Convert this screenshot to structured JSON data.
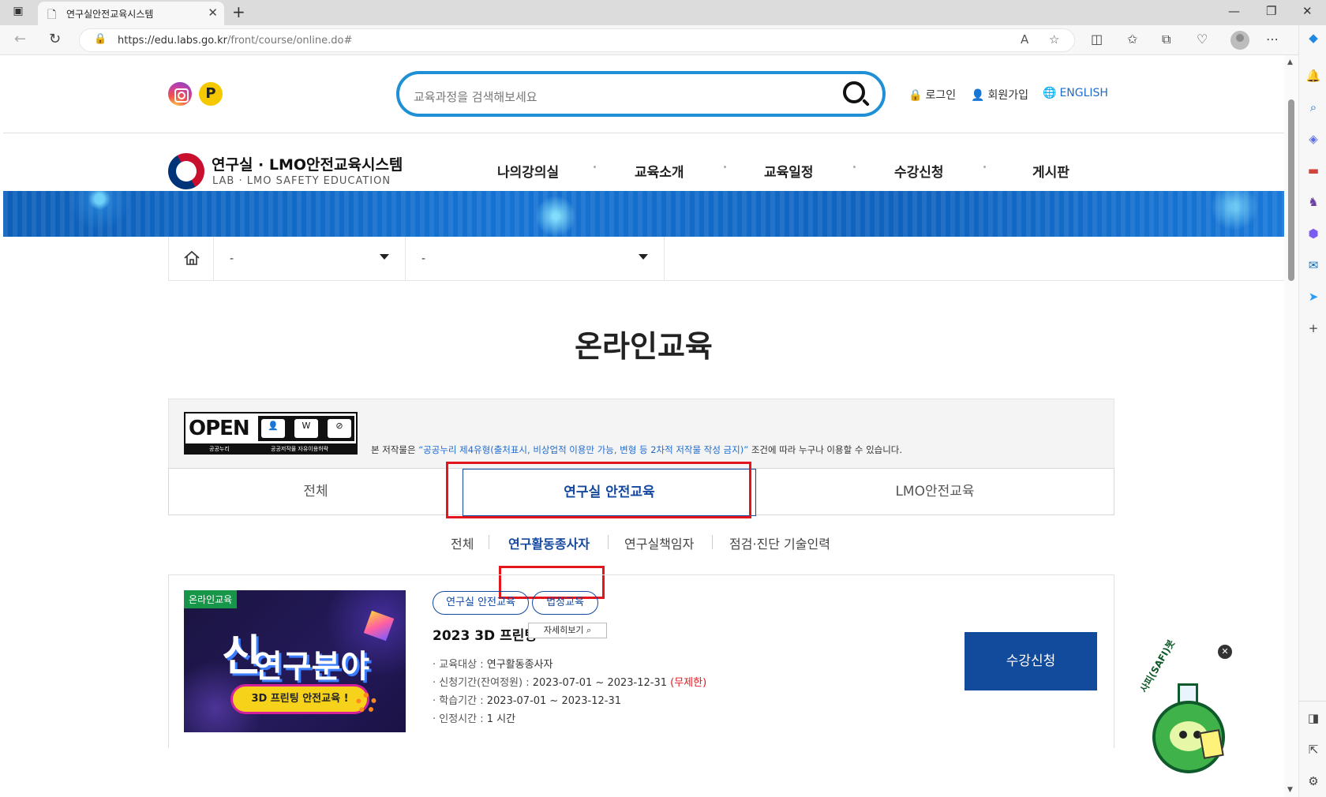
{
  "browser": {
    "tab_title": "연구실안전교육시스템",
    "url_host": "https://edu.labs.go.kr",
    "url_path": "/front/course/online.do#",
    "icons": [
      "sidebar-toggle-icon",
      "document-icon",
      "close-icon",
      "plus-icon",
      "back-icon",
      "reload-icon",
      "lock-icon",
      "read-aloud-icon",
      "favorite-star-icon",
      "split-screen-icon",
      "favorites-icon",
      "collections-icon",
      "browser-essentials-icon",
      "profile-icon",
      "more-icon",
      "copilot-icon"
    ]
  },
  "header": {
    "search_placeholder": "교육과정을 검색해보세요",
    "login": "로그인",
    "signup": "회원가입",
    "english": "ENGLISH",
    "logo_title": "연구실 · LMO안전교육시스템",
    "logo_sub": "LAB · LMO SAFETY EDUCATION",
    "sns_post_letter": "P"
  },
  "gnb": [
    "나의강의실",
    "교육소개",
    "교육일정",
    "수강신청",
    "게시판"
  ],
  "breadcrumb": {
    "select1": "-",
    "select2": "-"
  },
  "page_title": "온라인교육",
  "license": {
    "badge_open": "OPEN",
    "badge_left": "공공누리",
    "badge_right": "공공저작물 자유이용허락",
    "badge_items": [
      "출처표시",
      "상업용금지",
      "변경금지"
    ],
    "text_before": "본 저작물은 ",
    "text_highlight": "“공공누리 제4유형(출처표시, 비상업적 이용만 가능, 변형 등 2차적 저작물 작성 금지)”",
    "text_after": " 조건에 따라 누구나 이용할 수 있습니다."
  },
  "tabs": [
    "전체",
    "연구실 안전교육",
    "LMO안전교육"
  ],
  "active_tab": "연구실 안전교육",
  "subtabs": [
    "전체",
    "연구활동종사자",
    "연구실책임자",
    "점검·진단 기술인력"
  ],
  "active_subtab": "연구활동종사자",
  "course": {
    "thumb_tag": "온라인교육",
    "thumb_big1": "신",
    "thumb_big2": "연구분야",
    "thumb_pill": "3D 프린팅 안전교육 !",
    "chips": [
      "연구실 안전교육",
      "법정교육"
    ],
    "title": "2023 3D 프린팅",
    "detail_button": "자세히보기",
    "info": [
      {
        "label": "· 교육대상 : ",
        "value": "연구활동종사자",
        "extra": ""
      },
      {
        "label": "· 신청기간(잔여정원) : ",
        "value": "2023-07-01 ~ 2023-12-31 ",
        "extra": "(무제한)"
      },
      {
        "label": "· 학습기간 : ",
        "value": "2023-07-01 ~ 2023-12-31",
        "extra": ""
      },
      {
        "label": "· 인정시간 : ",
        "value": "1 시간",
        "extra": ""
      }
    ],
    "apply_button": "수강신청"
  },
  "mascot": {
    "label": "사피(SAFI)봇",
    "close": "✕"
  },
  "colors": {
    "primary": "#1549a0",
    "search_border": "#1f8fd6",
    "highlight_red": "#e2161c",
    "apply_bg": "#124a9c"
  }
}
